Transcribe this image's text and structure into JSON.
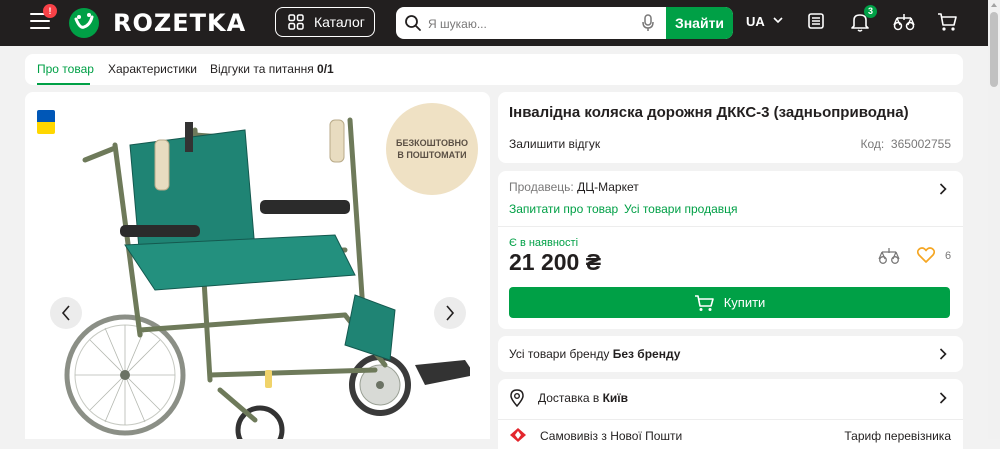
{
  "header": {
    "logo_text": "ROZETKA",
    "menu_badge": "!",
    "catalog_label": "Каталог",
    "search_placeholder": "Я шукаю...",
    "search_button": "Знайти",
    "language": "UA",
    "notifications_count": "3",
    "colors": {
      "background": "#221f1f",
      "accent": "#00a046",
      "alert": "#f84147"
    }
  },
  "tabs": [
    {
      "label": "Про товар",
      "active": true
    },
    {
      "label": "Характеристики",
      "active": false
    },
    {
      "label": "Відгуки та питання",
      "count": "0/1",
      "active": false
    }
  ],
  "gallery": {
    "promo_line1": "БЕЗКОШТОВНО",
    "promo_line2": "В ПОШТОМАТИ",
    "flag": "ukraine-flag-icon",
    "image": "wheelchair-photo"
  },
  "product": {
    "title": "Інвалідна коляска дорожня ДККС-3 (задньоприводна)",
    "review_link": "Залишити відгук",
    "code_label": "Код:",
    "code_value": "365002755"
  },
  "seller": {
    "label": "Продавець:",
    "name": "ДЦ-Маркет",
    "ask_link": "Запитати про товар",
    "all_goods_link": "Усі товари продавця"
  },
  "purchase": {
    "availability": "Є в наявності",
    "price": "21 200",
    "currency": "₴",
    "favorites_count": "6",
    "buy_label": "Купити"
  },
  "brand": {
    "label": "Усі товари бренду",
    "name": "Без бренду"
  },
  "delivery": {
    "label": "Доставка в",
    "city": "Київ",
    "pickup_label": "Самовивіз з Нової Пошти",
    "tariff_label": "Тариф перевізника"
  }
}
